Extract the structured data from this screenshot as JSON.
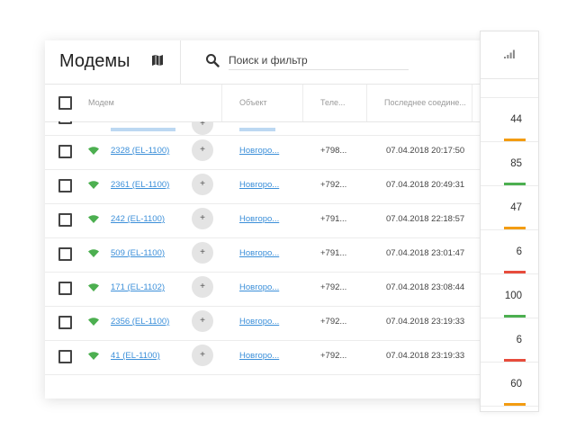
{
  "header": {
    "title": "Модемы",
    "search_placeholder": "Поиск и фильтр"
  },
  "columns": {
    "modem": "Модем",
    "object": "Объект",
    "phone": "Теле...",
    "last_connection": "Последнее соедине..."
  },
  "partial_row": {
    "add_label": "+"
  },
  "rows": [
    {
      "modem": "2328 (EL-1100)",
      "add_label": "+",
      "object": "Новгоро...",
      "phone": "+798...",
      "last_connection": "07.04.2018 20:17:50"
    },
    {
      "modem": "2361 (EL-1100)",
      "add_label": "+",
      "object": "Новгоро...",
      "phone": "+792...",
      "last_connection": "07.04.2018 20:49:31"
    },
    {
      "modem": "242 (EL-1100)",
      "add_label": "+",
      "object": "Новгоро...",
      "phone": "+791...",
      "last_connection": "07.04.2018 22:18:57"
    },
    {
      "modem": "509 (EL-1100)",
      "add_label": "+",
      "object": "Новгоро...",
      "phone": "+791...",
      "last_connection": "07.04.2018 23:01:47"
    },
    {
      "modem": "171 (EL-1102)",
      "add_label": "+",
      "object": "Новгоро...",
      "phone": "+792...",
      "last_connection": "07.04.2018 23:08:44"
    },
    {
      "modem": "2356 (EL-1100)",
      "add_label": "+",
      "object": "Новгоро...",
      "phone": "+792...",
      "last_connection": "07.04.2018 23:19:33"
    },
    {
      "modem": "41 (EL-1100)",
      "add_label": "+",
      "object": "Новгоро...",
      "phone": "+792...",
      "last_connection": "07.04.2018 23:19:33"
    }
  ],
  "signal": {
    "icon": "signal-strength-icon",
    "values": [
      {
        "value": "44",
        "color": "#f39c12"
      },
      {
        "value": "85",
        "color": "#4caf50"
      },
      {
        "value": "47",
        "color": "#f39c12"
      },
      {
        "value": "6",
        "color": "#e74c3c"
      },
      {
        "value": "100",
        "color": "#4caf50"
      },
      {
        "value": "6",
        "color": "#e74c3c"
      },
      {
        "value": "60",
        "color": "#f39c12"
      }
    ]
  },
  "colors": {
    "link": "#3b8fd9",
    "wifi": "#4caf50"
  }
}
